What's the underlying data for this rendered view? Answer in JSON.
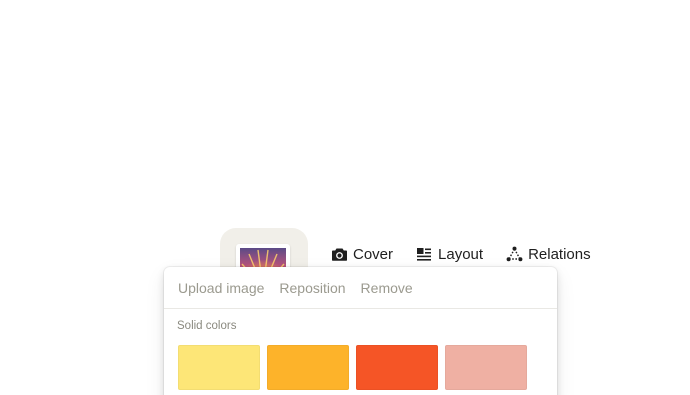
{
  "page_icon": {
    "name": "sunset-image-icon"
  },
  "toolbar": {
    "items": [
      {
        "label": "Cover",
        "icon": "camera-icon"
      },
      {
        "label": "Layout",
        "icon": "layout-icon"
      },
      {
        "label": "Relations",
        "icon": "relations-icon"
      }
    ]
  },
  "cover_menu": {
    "tabs": [
      {
        "label": "Upload image"
      },
      {
        "label": "Reposition"
      },
      {
        "label": "Remove"
      }
    ],
    "section_label": "Solid colors",
    "colors": [
      "#fde677",
      "#fdb32a",
      "#f55526",
      "#efb0a3"
    ]
  }
}
